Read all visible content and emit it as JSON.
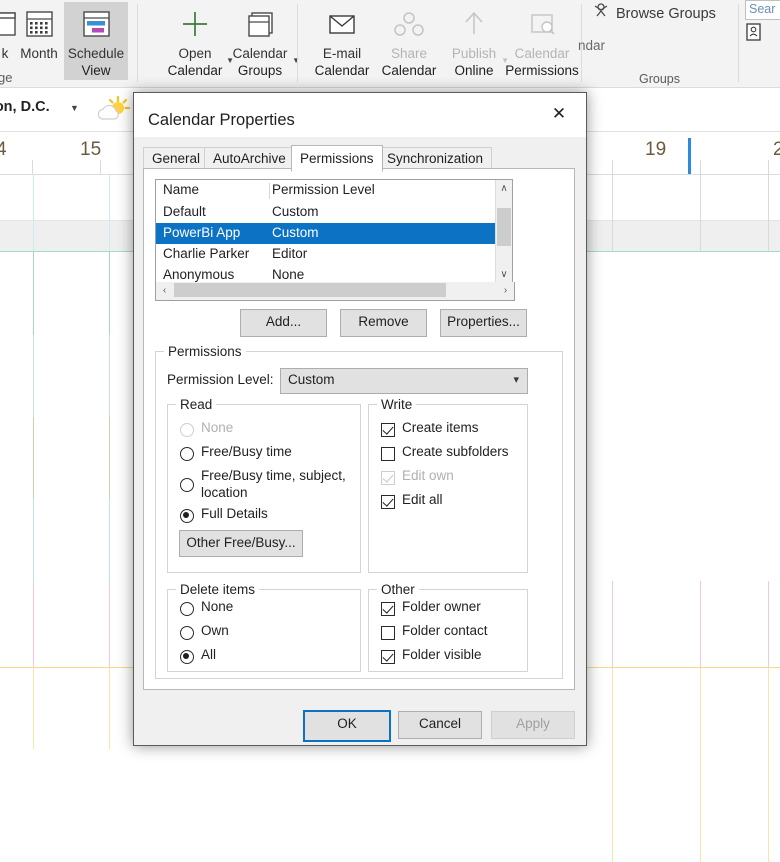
{
  "ribbon": {
    "arrange_group_label": "ge",
    "buttons": [
      {
        "name": "week",
        "label": "k",
        "sublabel": "",
        "disabled": false,
        "selected": false
      },
      {
        "name": "month",
        "label": "Month",
        "sublabel": "",
        "disabled": false,
        "selected": false
      },
      {
        "name": "schedule-view",
        "label": "Schedule",
        "sublabel": "View",
        "disabled": false,
        "selected": true
      },
      {
        "name": "open-calendar",
        "label": "Open",
        "sublabel": "Calendar",
        "disabled": false,
        "selected": false,
        "dropdown": true
      },
      {
        "name": "calendar-groups",
        "label": "Calendar",
        "sublabel": "Groups",
        "disabled": false,
        "selected": false,
        "dropdown": true
      },
      {
        "name": "email-calendar",
        "label": "E-mail",
        "sublabel": "Calendar",
        "disabled": false,
        "selected": false
      },
      {
        "name": "share-calendar",
        "label": "Share",
        "sublabel": "Calendar",
        "disabled": true,
        "selected": false
      },
      {
        "name": "publish-online",
        "label": "Publish",
        "sublabel": "Online",
        "disabled": true,
        "selected": false,
        "dropdown": true
      },
      {
        "name": "calendar-permissions",
        "label": "Calendar",
        "sublabel": "Permissions",
        "disabled": true,
        "selected": false
      }
    ],
    "groups_label": "Groups",
    "browse_groups": "Browse Groups",
    "manage_calendars_partial": "ndar",
    "search_placeholder": "Sear"
  },
  "calendar": {
    "weather_city": "ton,  D.C.",
    "weather_icon": "sun-cloud-icon",
    "dates": [
      "4",
      "15",
      "19",
      "2"
    ]
  },
  "dialog": {
    "title": "Calendar Properties",
    "close_label": "✕",
    "tabs": [
      {
        "label": "General",
        "active": false
      },
      {
        "label": "AutoArchive",
        "active": false
      },
      {
        "label": "Permissions",
        "active": true
      },
      {
        "label": "Synchronization",
        "active": false
      }
    ],
    "list": {
      "headers": [
        "Name",
        "Permission Level"
      ],
      "rows": [
        {
          "name": "Default",
          "level": "Custom",
          "selected": false
        },
        {
          "name": "PowerBi App",
          "level": "Custom",
          "selected": true
        },
        {
          "name": "Charlie Parker",
          "level": "Editor",
          "selected": false
        },
        {
          "name": "Anonymous",
          "level": "None",
          "selected": false
        }
      ],
      "scroll_up": "∧",
      "scroll_down": "∨",
      "scroll_left": "‹",
      "scroll_right": "›"
    },
    "list_buttons": [
      {
        "label": "Add...",
        "disabled": false
      },
      {
        "label": "Remove",
        "disabled": false
      },
      {
        "label": "Properties...",
        "disabled": false
      }
    ],
    "permissions_group_label": "Permissions",
    "permission_level_label": "Permission Level:",
    "permission_level_value": "Custom",
    "read": {
      "label": "Read",
      "options": [
        {
          "label": "None",
          "checked": false,
          "disabled": true
        },
        {
          "label": "Free/Busy time",
          "checked": false,
          "disabled": false
        },
        {
          "label": "Free/Busy time, subject, location",
          "checked": false,
          "disabled": false
        },
        {
          "label": "Full Details",
          "checked": true,
          "disabled": false
        }
      ],
      "other_button": "Other Free/Busy..."
    },
    "write": {
      "label": "Write",
      "options": [
        {
          "label": "Create items",
          "checked": true,
          "disabled": false
        },
        {
          "label": "Create subfolders",
          "checked": false,
          "disabled": false
        },
        {
          "label": "Edit own",
          "checked": true,
          "disabled": true
        },
        {
          "label": "Edit all",
          "checked": true,
          "disabled": false
        }
      ]
    },
    "delete_items": {
      "label": "Delete items",
      "options": [
        {
          "label": "None",
          "checked": false,
          "disabled": false
        },
        {
          "label": "Own",
          "checked": false,
          "disabled": false
        },
        {
          "label": "All",
          "checked": true,
          "disabled": false
        }
      ]
    },
    "other": {
      "label": "Other",
      "options": [
        {
          "label": "Folder owner",
          "checked": true,
          "disabled": false
        },
        {
          "label": "Folder contact",
          "checked": false,
          "disabled": false
        },
        {
          "label": "Folder visible",
          "checked": true,
          "disabled": false
        }
      ]
    },
    "footer": [
      {
        "label": "OK",
        "disabled": false,
        "default": true
      },
      {
        "label": "Cancel",
        "disabled": false,
        "default": false
      },
      {
        "label": "Apply",
        "disabled": true,
        "default": false
      }
    ]
  },
  "colors": {
    "accent": "#0b72c4",
    "selection": "#0b72c4",
    "dialog_bg": "#f0f0f0",
    "ribbon_bg": "#f3f3f3"
  }
}
